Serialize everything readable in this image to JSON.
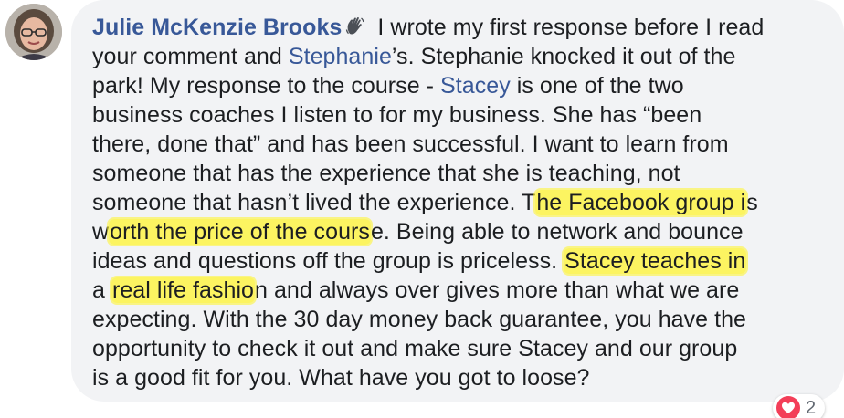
{
  "comment": {
    "author": "Julie McKenzie Brooks",
    "author_icon": "waving-hand-icon",
    "lines": {
      "l1": " I wrote my first response before I read",
      "l2_a": "your comment and ",
      "l2_mention": "Stephanie",
      "l2_b": "’s. Stephanie knocked it out of the",
      "l3_a": "park! My response to the course - ",
      "l3_mention": "Stacey",
      "l3_b": " is one of the two",
      "l4": "business coaches I listen to for my business. She has “been",
      "l5": "there, done that” and has been successful. I want to learn from",
      "l6": "someone that has the experience that she is teaching, not",
      "l7_a": "someone that hasn’t lived the experience. T",
      "l7_hl": "he Facebook group i",
      "l7_b": "s",
      "l8_a": "w",
      "l8_hl": "orth the price of the cours",
      "l8_b": "e. Being able to network and bounce",
      "l9_a": "ideas and questions off the group is priceless. ",
      "l9_hl": "Stacey teaches in",
      "l10_a": "a ",
      "l10_hl": "real life fashio",
      "l10_b": "n and always over gives more than what we are",
      "l11": "expecting. With the 30 day money back guarantee, you have the",
      "l12": "opportunity to check it out and make sure Stacey and our group",
      "l13": "is a good fit for you. What have you got to loose?"
    }
  },
  "reactions": {
    "icon": "heart-icon",
    "count": "2"
  },
  "colors": {
    "author_link": "#385898",
    "bubble_bg": "#f2f3f5",
    "highlight": "#fff428",
    "heart": "#f33e58"
  }
}
